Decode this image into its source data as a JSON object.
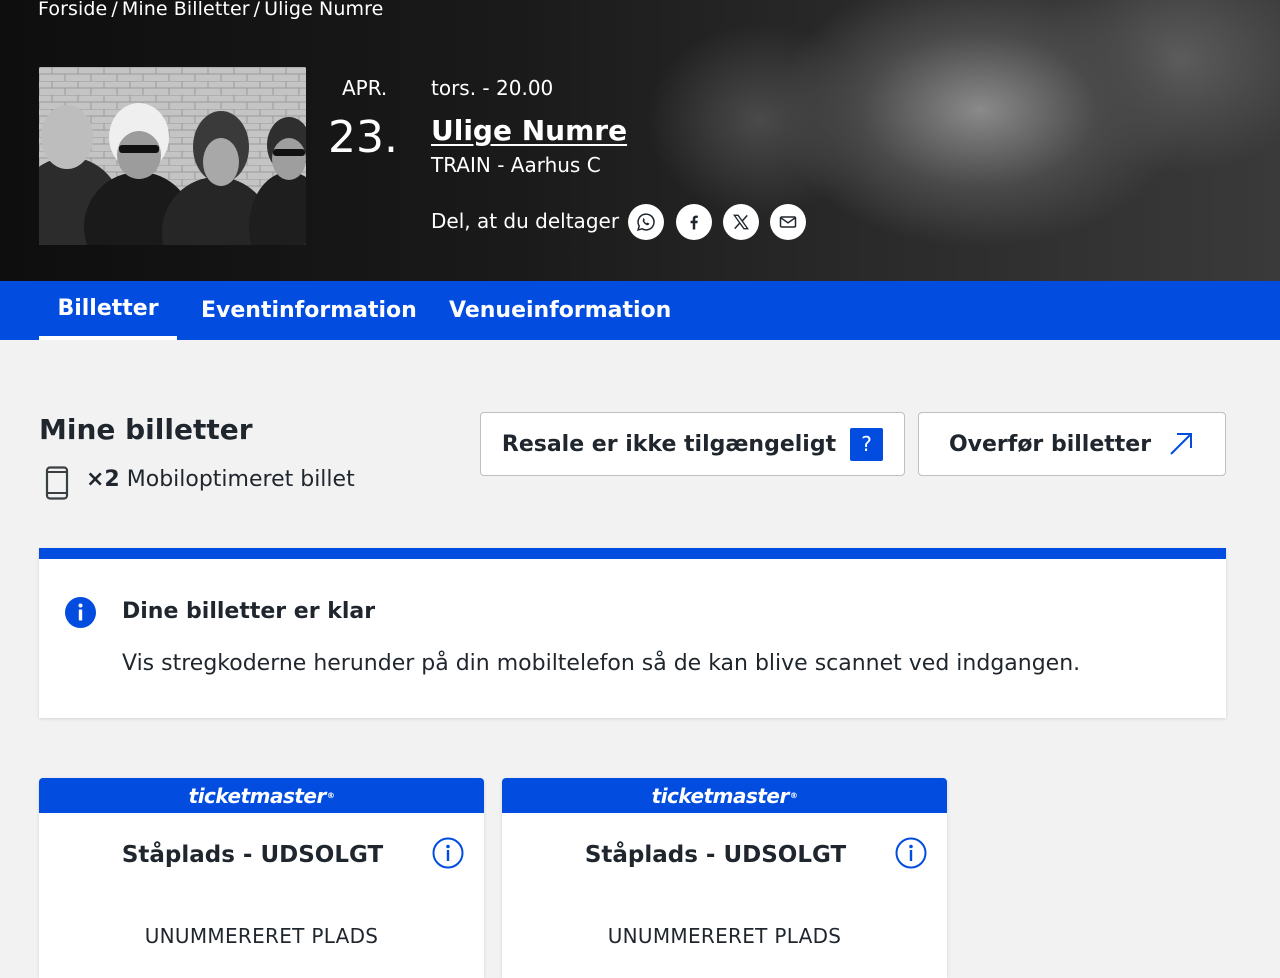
{
  "breadcrumb": {
    "items": [
      "Forside",
      "Mine Billetter",
      "Ulige Numre"
    ],
    "separator": "/"
  },
  "event": {
    "month": "APR.",
    "day": "23.",
    "time": "tors. - 20.00",
    "title": "Ulige Numre",
    "venue": "TRAIN - Aarhus C",
    "share_label": "Del, at du deltager"
  },
  "share_icons": [
    "whatsapp-icon",
    "facebook-icon",
    "x-icon",
    "mail-icon"
  ],
  "tabs": [
    {
      "label": "Billetter",
      "active": true
    },
    {
      "label": "Eventinformation",
      "active": false
    },
    {
      "label": "Venueinformation",
      "active": false
    }
  ],
  "my_tickets": {
    "title": "Mine billetter",
    "count_label": "×2",
    "ticket_type": "Mobiloptimeret billet"
  },
  "actions": {
    "resale_label": "Resale er ikke tilgængeligt",
    "resale_help": "?",
    "transfer_label": "Overfør billetter"
  },
  "alert": {
    "title": "Dine billetter er klar",
    "body": "Vis stregkoderne herunder på din mobiltelefon så de kan blive scannet ved indgangen."
  },
  "tickets": [
    {
      "brand": "ticketmaster",
      "type": "Ståplads - UDSOLGT",
      "seat": "UNUMMERERET PLADS"
    },
    {
      "brand": "ticketmaster",
      "type": "Ståplads - UDSOLGT",
      "seat": "UNUMMERERET PLADS"
    }
  ],
  "colors": {
    "brand_blue": "#024DDF",
    "text_dark": "#1F262D",
    "page_bg": "#F2F2F2"
  }
}
